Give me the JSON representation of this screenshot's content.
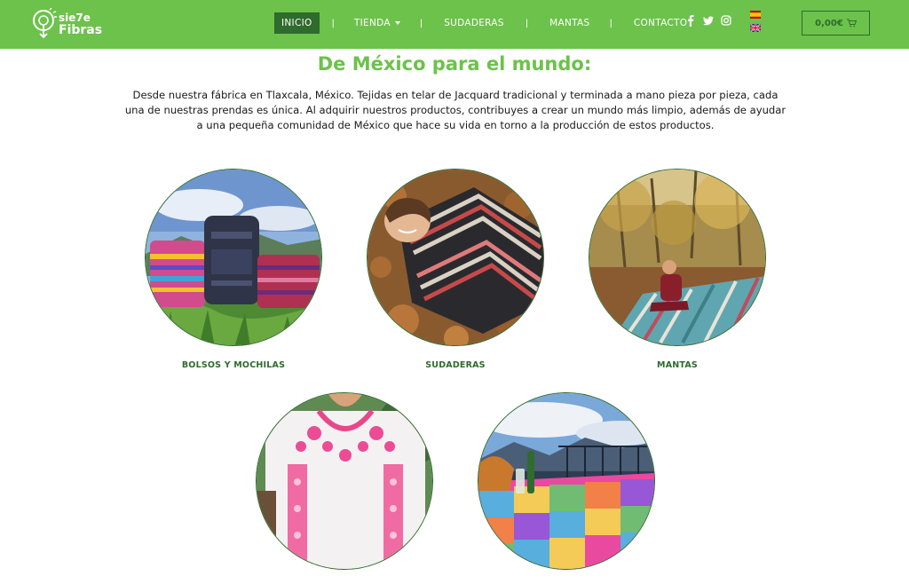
{
  "header": {
    "logo": {
      "line1": "sie7e",
      "line2": "Fibras"
    },
    "nav": [
      {
        "label": "INICIO",
        "active": true
      },
      {
        "label": "TIENDA",
        "dropdown": true
      },
      {
        "label": "SUDADERAS"
      },
      {
        "label": "MANTAS"
      },
      {
        "label": "CONTACTO"
      }
    ],
    "separator": "|",
    "social": [
      "facebook-icon",
      "twitter-icon",
      "instagram-icon"
    ],
    "languages": [
      "es-flag",
      "en-flag"
    ],
    "cart_total": "0,00€"
  },
  "main": {
    "title": "De México para el mundo:",
    "intro": "Desde nuestra fábrica en Tlaxcala, México. Tejidas en telar de Jacquard tradicional y terminada a mano pieza por pieza, cada una de nuestras prendas es única. Al adquirir nuestros productos, contribuyes a crear un mundo más limpio, además de ayudar a una pequeña comunidad de México que hace su vida en torno a la producción de estos productos.",
    "categories": [
      {
        "label": "BOLSOS Y MOCHILAS"
      },
      {
        "label": "SUDADERAS"
      },
      {
        "label": "MANTAS"
      },
      {
        "label": ""
      },
      {
        "label": ""
      }
    ]
  },
  "colors": {
    "brand_green": "#6cc24a",
    "dark_green": "#2e6b2c"
  }
}
